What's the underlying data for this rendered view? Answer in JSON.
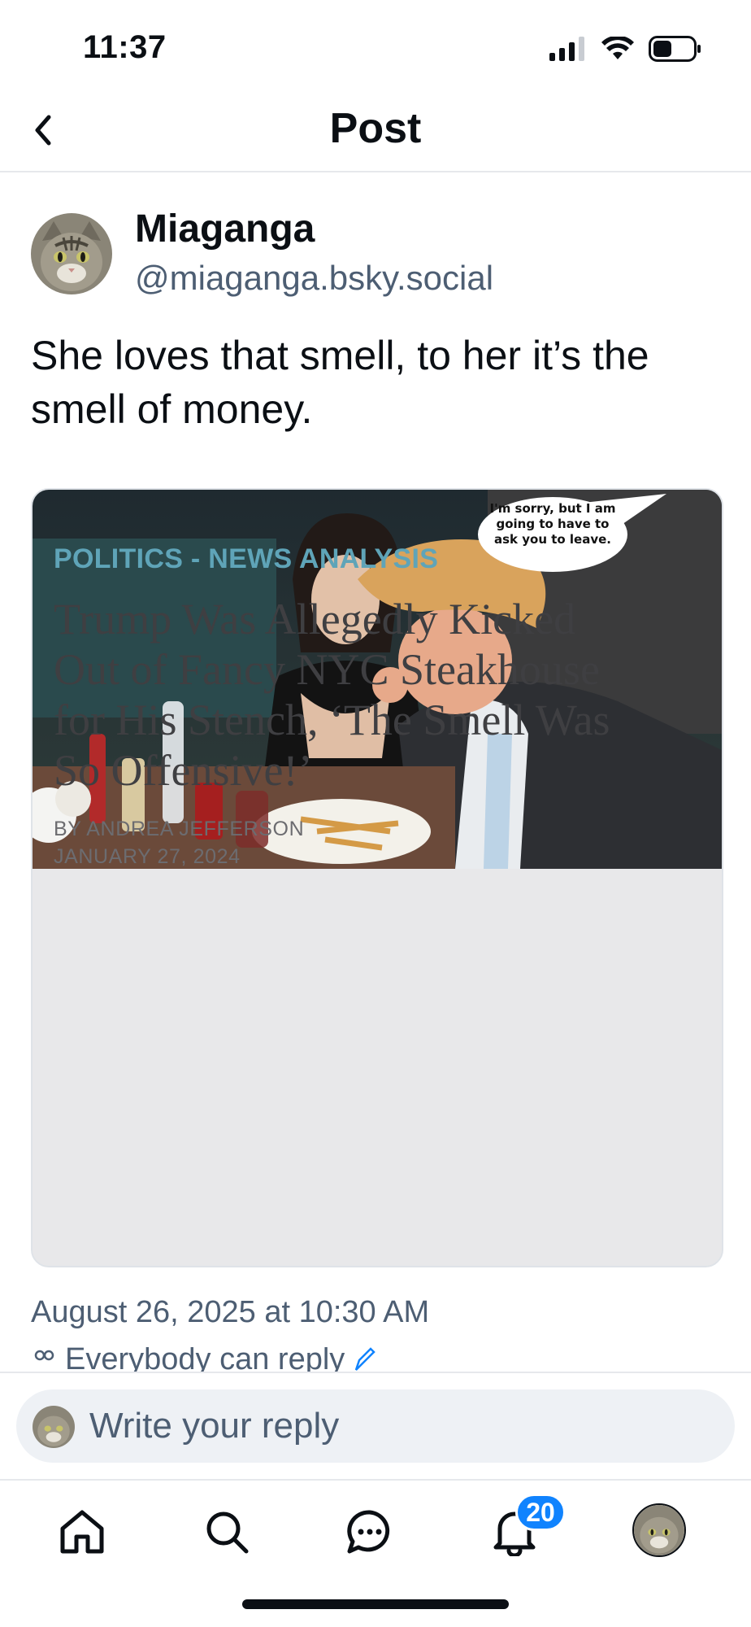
{
  "status_bar": {
    "time": "11:37"
  },
  "nav": {
    "title": "Post"
  },
  "post": {
    "author_name": "Miaganga",
    "author_handle": "@miaganga.bsky.social",
    "text": "She loves that smell, to her it’s the smell of money.",
    "date": "August 26, 2025 at 10:30 AM",
    "reply_permission": "Everybody can reply"
  },
  "embed": {
    "speech_bubble": "I'm sorry, but I am going to have to ask you to leave.",
    "kicker": "POLITICS - NEWS ANALYSIS",
    "headline": "Trump Was Allegedly Kicked Out of Fancy NYC Steakhouse for His Stench, ‘The Smell Was So Offensive!’",
    "byline": "BY ANDREA JEFFERSON",
    "byline_date": "JANUARY 27, 2024"
  },
  "reply": {
    "placeholder": "Write your reply"
  },
  "tabbar": {
    "notifications_badge": "20"
  },
  "colors": {
    "accent": "#1083fe",
    "muted": "#4d5e73",
    "kicker": "#5fa4b8"
  }
}
